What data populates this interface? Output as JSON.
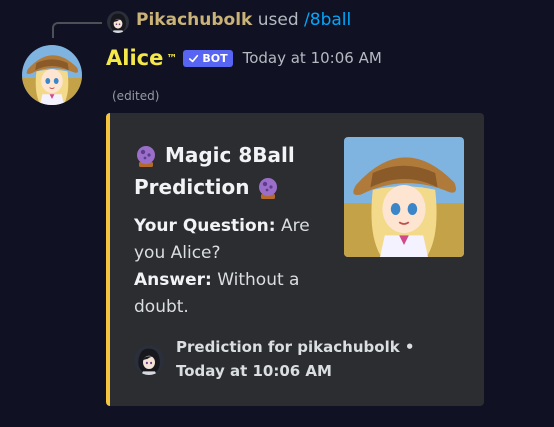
{
  "reply": {
    "user": "Pikachubolk",
    "used_text": "used",
    "command": "/8ball"
  },
  "message": {
    "author": "Alice",
    "trademark": "™",
    "badge": "BOT",
    "timestamp": "Today at 10:06 AM",
    "edited": "(edited)"
  },
  "embed": {
    "title_line1": "Magic 8Ball",
    "title_line2": "Prediction",
    "question_label": "Your Question:",
    "question": "Are you Alice?",
    "answer_label": "Answer:",
    "answer": "Without a doubt.",
    "footer": "Prediction for pikachubolk • Today at 10:06 AM",
    "accent_color": "#f5c542",
    "orb_icon": "crystal-ball-icon"
  },
  "colors": {
    "background": "#111124",
    "username": "#c9b376",
    "command": "#00a8fc",
    "author": "#f5e94a",
    "bot_badge": "#5865f2",
    "embed_bg": "#2b2d31"
  }
}
